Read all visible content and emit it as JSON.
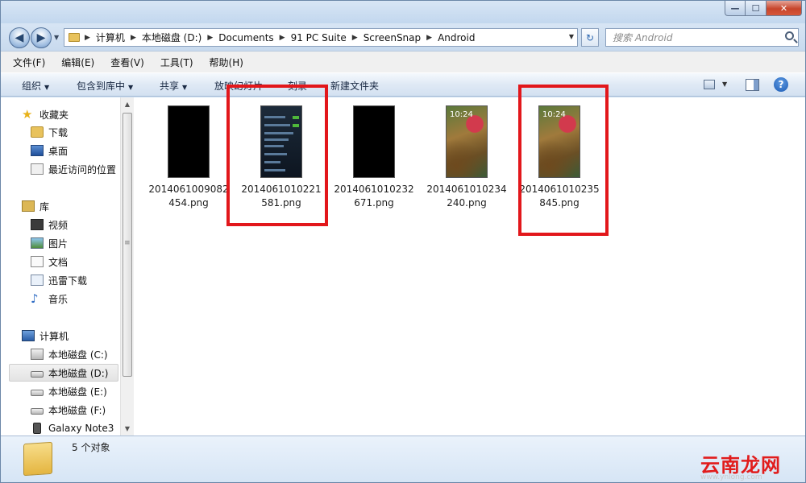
{
  "window": {
    "minimize_glyph": "—",
    "maximize_glyph": "☐",
    "close_glyph": "✕"
  },
  "address": {
    "breadcrumbs": [
      "计算机",
      "本地磁盘 (D:)",
      "Documents",
      "91 PC Suite",
      "ScreenSnap",
      "Android"
    ],
    "search_placeholder": "搜索 Android"
  },
  "menu": {
    "items": [
      "文件(F)",
      "编辑(E)",
      "查看(V)",
      "工具(T)",
      "帮助(H)"
    ]
  },
  "commands": {
    "organize": "组织",
    "include_library": "包含到库中",
    "share": "共享",
    "slideshow": "放映幻灯片",
    "burn": "刻录",
    "new_folder": "新建文件夹"
  },
  "nav": {
    "favorites": "收藏夹",
    "downloads": "下载",
    "desktop": "桌面",
    "recent": "最近访问的位置",
    "libraries": "库",
    "videos": "视频",
    "pictures": "图片",
    "documents": "文档",
    "thunder": "迅雷下载",
    "music": "音乐",
    "computer": "计算机",
    "drive_c": "本地磁盘 (C:)",
    "drive_d": "本地磁盘 (D:)",
    "drive_e": "本地磁盘 (E:)",
    "drive_f": "本地磁盘 (F:)",
    "phone": "Galaxy Note3"
  },
  "files": [
    {
      "name": "20140610090824 54.png",
      "line1": "2014061009082",
      "line2": "454.png",
      "thumb": "black",
      "highlighted": false
    },
    {
      "name": "20140610102215 81.png",
      "line1": "2014061010221",
      "line2": "581.png",
      "thumb": "settings",
      "highlighted": true
    },
    {
      "name": "20140610102326 71.png",
      "line1": "2014061010232",
      "line2": "671.png",
      "thumb": "black",
      "highlighted": false
    },
    {
      "name": "20140610102342 40.png",
      "line1": "2014061010234",
      "line2": "240.png",
      "thumb": "lockscreen",
      "highlighted": false
    },
    {
      "name": "20140610102358 45.png",
      "line1": "2014061010235",
      "line2": "845.png",
      "thumb": "lockscreen",
      "highlighted": true
    }
  ],
  "thumb_clock": "10:24",
  "status": {
    "count": "5 个对象"
  },
  "watermark": {
    "text": "云南龙网",
    "url": "www.ynlong.com"
  },
  "colors": {
    "highlight": "#e2171b",
    "accent": "#2b66b0"
  }
}
